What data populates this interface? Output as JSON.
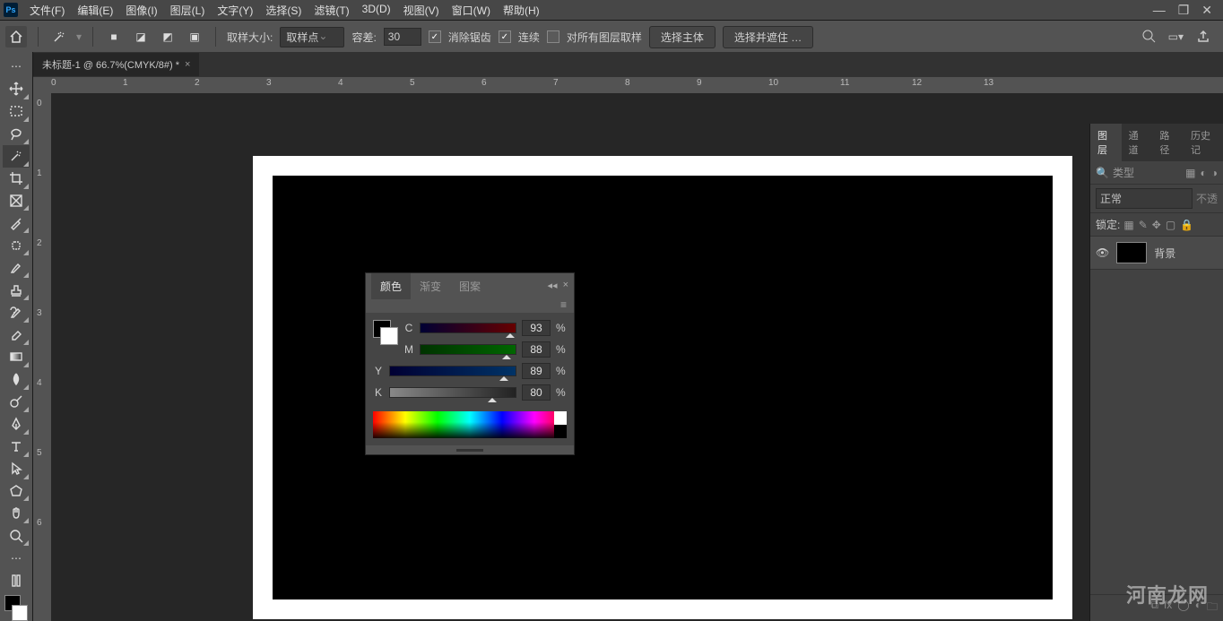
{
  "menu": {
    "items": [
      "文件(F)",
      "编辑(E)",
      "图像(I)",
      "图层(L)",
      "文字(Y)",
      "选择(S)",
      "滤镜(T)",
      "3D(D)",
      "视图(V)",
      "窗口(W)",
      "帮助(H)"
    ]
  },
  "options": {
    "sample_size_label": "取样大小:",
    "sample_size_value": "取样点",
    "tolerance_label": "容差:",
    "tolerance_value": "30",
    "antialias": "消除锯齿",
    "contiguous": "连续",
    "all_layers": "对所有图层取样",
    "select_subject": "选择主体",
    "select_and_mask": "选择并遮住 …"
  },
  "tab": {
    "title": "未标题-1 @ 66.7%(CMYK/8#) *"
  },
  "ruler_h": [
    "0",
    "1",
    "2",
    "3",
    "4",
    "5",
    "6",
    "7",
    "8",
    "9",
    "10",
    "11",
    "12",
    "13"
  ],
  "ruler_v": [
    "0",
    "1",
    "2",
    "3",
    "4",
    "5",
    "6"
  ],
  "color_panel": {
    "tabs": [
      "颜色",
      "渐变",
      "图案"
    ],
    "sliders": [
      {
        "label": "C",
        "value": "93",
        "unit": "%",
        "grad": "linear-gradient(to right,#003,#600)",
        "pos": 90
      },
      {
        "label": "M",
        "value": "88",
        "unit": "%",
        "grad": "linear-gradient(to right,#030,#060)",
        "pos": 86
      },
      {
        "label": "Y",
        "value": "89",
        "unit": "%",
        "grad": "linear-gradient(to right,#003,#036)",
        "pos": 87
      },
      {
        "label": "K",
        "value": "80",
        "unit": "%",
        "grad": "linear-gradient(to right,#888,#222)",
        "pos": 78
      }
    ]
  },
  "right": {
    "tabs": [
      "图层",
      "通道",
      "路径",
      "历史记"
    ],
    "kind": "类型",
    "blend": "正常",
    "opacity_lbl": "不透",
    "lock_lbl": "锁定:",
    "layer_name": "背景"
  },
  "watermark": "河南龙网"
}
